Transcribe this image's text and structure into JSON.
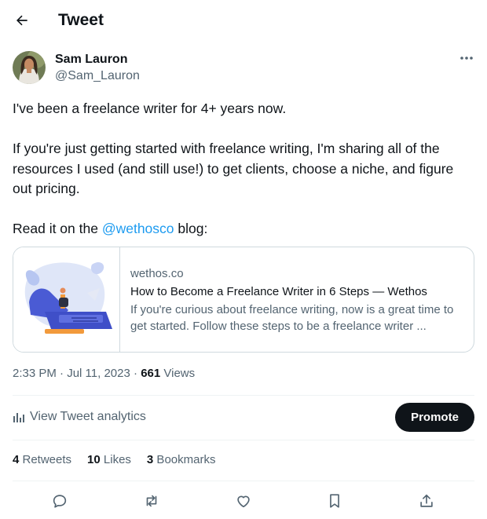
{
  "header": {
    "title": "Tweet",
    "back_icon": "arrow-left-icon"
  },
  "author": {
    "name": "Sam Lauron",
    "handle": "@Sam_Lauron"
  },
  "tweet": {
    "text_before_mention": "I've been a freelance writer for 4+ years now.\n\nIf you're just getting started with freelance writing, I'm sharing all of the resources I used (and still use!) to get clients, choose a niche, and figure out pricing.\n\nRead it on the ",
    "mention": "@wethosco",
    "text_after_mention": " blog:"
  },
  "card": {
    "domain": "wethos.co",
    "title": "How to Become a Freelance Writer in 6 Steps — Wethos",
    "description": "If you're curious about freelance writing, now is a great time to get started. Follow these steps to be a freelance writer ..."
  },
  "meta": {
    "time": "2:33 PM",
    "separator": " · ",
    "date": "Jul 11, 2023",
    "views_count": "661",
    "views_label": " Views"
  },
  "analytics": {
    "label": "View Tweet analytics"
  },
  "promote": {
    "label": "Promote"
  },
  "stats": {
    "retweets_count": "4",
    "retweets_label": " Retweets",
    "likes_count": "10",
    "likes_label": " Likes",
    "bookmarks_count": "3",
    "bookmarks_label": " Bookmarks"
  },
  "colors": {
    "accent": "#1d9bf0",
    "text": "#0f1419",
    "secondary": "#536471",
    "border": "#cfd9de"
  },
  "action_icons": [
    "reply-icon",
    "retweet-icon",
    "like-icon",
    "bookmark-icon",
    "share-icon"
  ]
}
